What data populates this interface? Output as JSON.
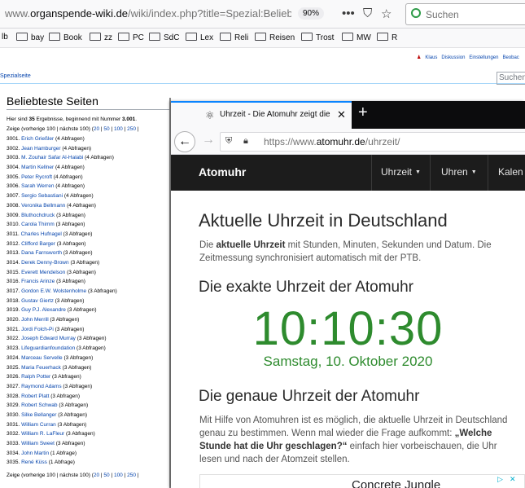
{
  "win1": {
    "url_prefix": "www.",
    "url_domain": "organspende-wiki.de",
    "url_path": "/wiki/index.php?title=Spezial:Beliebteste_Se",
    "zoom": "90%",
    "search_placeholder": "Suchen",
    "bookmarks": [
      "lb",
      "bay",
      "Book",
      "zz",
      "PC",
      "SdC",
      "Lex",
      "Reli",
      "Reisen",
      "Trost",
      "MW",
      "R"
    ],
    "user_links": [
      "Klaus",
      "Diskussion",
      "Einstellungen",
      "Beobac"
    ],
    "special_tab": "Spezialseite",
    "wiki_search": "Suchen",
    "page_title": "Beliebteste Seiten",
    "info_pre": "Hier sind ",
    "info_count": "35",
    "info_mid": " Ergebnisse, beginnend mit Nummer ",
    "info_start": "3.001",
    "info_end": ".",
    "nav": {
      "zeige": "Zeige (",
      "vorherige": "vorherige 100",
      "pipe1": " | ",
      "naechste": "nächste 100",
      "mid": ") (",
      "n20": "20",
      "n50": "50",
      "n100": "100",
      "n250": "250",
      "sep": " | "
    },
    "results": [
      {
        "num": "3001.",
        "name": "Erich Grießler",
        "count": "(4 Abfragen)"
      },
      {
        "num": "3002.",
        "name": "Jean Hamburger",
        "count": "(4 Abfragen)"
      },
      {
        "num": "3003.",
        "name": "M. Zouhair Safar Al-Halabi",
        "count": "(4 Abfragen)"
      },
      {
        "num": "3004.",
        "name": "Martin Kellner",
        "count": "(4 Abfragen)"
      },
      {
        "num": "3005.",
        "name": "Peter Rycroft",
        "count": "(4 Abfragen)"
      },
      {
        "num": "3006.",
        "name": "Sarah Werren",
        "count": "(4 Abfragen)"
      },
      {
        "num": "3007.",
        "name": "Sergio Sebastiani",
        "count": "(4 Abfragen)"
      },
      {
        "num": "3008.",
        "name": "Veronika Bellmann",
        "count": "(4 Abfragen)"
      },
      {
        "num": "3009.",
        "name": "Bluthochdruck",
        "count": "(3 Abfragen)"
      },
      {
        "num": "3010.",
        "name": "Carola Thimm",
        "count": "(3 Abfragen)"
      },
      {
        "num": "3011.",
        "name": "Charles Hufnagel",
        "count": "(3 Abfragen)"
      },
      {
        "num": "3012.",
        "name": "Clifford Barger",
        "count": "(3 Abfragen)"
      },
      {
        "num": "3013.",
        "name": "Dana Farnsworth",
        "count": "(3 Abfragen)"
      },
      {
        "num": "3014.",
        "name": "Derek Denny-Brown",
        "count": "(3 Abfragen)"
      },
      {
        "num": "3015.",
        "name": "Everett Mendelson",
        "count": "(3 Abfragen)"
      },
      {
        "num": "3016.",
        "name": "Francis Arinze",
        "count": "(3 Abfragen)"
      },
      {
        "num": "3017.",
        "name": "Gordon E.W. Wolstenholme",
        "count": "(3 Abfragen)"
      },
      {
        "num": "3018.",
        "name": "Gustav Giertz",
        "count": "(3 Abfragen)"
      },
      {
        "num": "3019.",
        "name": "Guy P.J. Alexandre",
        "count": "(3 Abfragen)"
      },
      {
        "num": "3020.",
        "name": "John Merrill",
        "count": "(3 Abfragen)"
      },
      {
        "num": "3021.",
        "name": "Jordi Folch-Pi",
        "count": "(3 Abfragen)"
      },
      {
        "num": "3022.",
        "name": "Joseph Edward Murray",
        "count": "(3 Abfragen)"
      },
      {
        "num": "3023.",
        "name": "Lifeguardianfoundation",
        "count": "(3 Abfragen)"
      },
      {
        "num": "3024.",
        "name": "Marceau Servelle",
        "count": "(3 Abfragen)"
      },
      {
        "num": "3025.",
        "name": "Maria Feuerhack",
        "count": "(3 Abfragen)"
      },
      {
        "num": "3026.",
        "name": "Ralph Potter",
        "count": "(3 Abfragen)"
      },
      {
        "num": "3027.",
        "name": "Raymond Adams",
        "count": "(3 Abfragen)"
      },
      {
        "num": "3028.",
        "name": "Robert Platt",
        "count": "(3 Abfragen)"
      },
      {
        "num": "3029.",
        "name": "Robert Schwab",
        "count": "(3 Abfragen)"
      },
      {
        "num": "3030.",
        "name": "Silke Bellanger",
        "count": "(3 Abfragen)"
      },
      {
        "num": "3031.",
        "name": "William Curran",
        "count": "(3 Abfragen)"
      },
      {
        "num": "3032.",
        "name": "William R. LaFleur",
        "count": "(3 Abfragen)"
      },
      {
        "num": "3033.",
        "name": "William Sweet",
        "count": "(3 Abfragen)"
      },
      {
        "num": "3034.",
        "name": "John Martin",
        "count": "(1 Abfrage)"
      },
      {
        "num": "3035.",
        "name": "René Küss",
        "count": "(1 Abfrage)"
      }
    ]
  },
  "win2": {
    "tab_title": "Uhrzeit - Die Atomuhr zeigt die",
    "url_prefix": "https://www.",
    "url_domain": "atomuhr.de",
    "url_path": "/uhrzeit/",
    "brand": "Atomuhr",
    "menu": [
      "Uhrzeit",
      "Uhren",
      "Kalen"
    ],
    "h1": "Aktuelle Uhrzeit in Deutschland",
    "p1_pre": "Die ",
    "p1_bold": "aktuelle Uhrzeit",
    "p1_post": " mit Stunden, Minuten, Sekunden und Datum. Die Zeitmessung synchronisiert automatisch mit der PTB.",
    "h2a": "Die exakte Uhrzeit der Atomuhr",
    "clock": "10:10:30",
    "date": "Samstag, 10. Oktober 2020",
    "h2b": "Die genaue Uhrzeit der Atomuhr",
    "p2_pre": "Mit Hilfe von Atomuhren ist es möglich, die aktuelle Uhrzeit in Deutschland genau zu bestimmen. Wenn mal wieder die Frage aufkommt: ",
    "p2_bold": "„Welche Stunde hat die Uhr geschlagen?“",
    "p2_post": " einfach hier vorbeischauen, die Uhr lesen und nach der Atomzeit stellen.",
    "ad_text": "Concrete Jungle"
  },
  "colors": {
    "clock_green": "#2e8b2e",
    "wiki_link": "#0645ad",
    "site_header": "#1c1c1c",
    "active_tab_accent": "#0a84ff"
  }
}
